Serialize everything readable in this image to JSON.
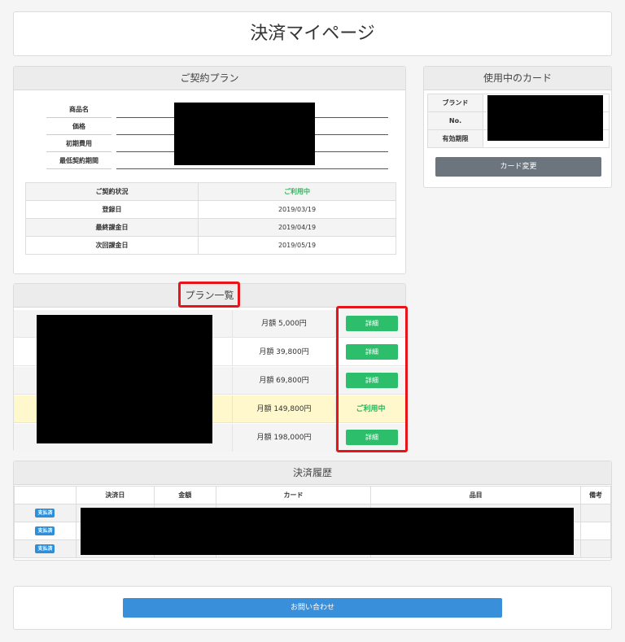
{
  "page": {
    "title": "決済マイページ"
  },
  "contract": {
    "heading": "ご契約プラン",
    "info_labels": [
      "商品名",
      "価格",
      "初期費用",
      "最低契約期間"
    ],
    "status_rows": [
      {
        "label": "ご契約状況",
        "value": "ご利用中"
      },
      {
        "label": "登録日",
        "value": "2019/03/19"
      },
      {
        "label": "最終課金日",
        "value": "2019/04/19"
      },
      {
        "label": "次回課金日",
        "value": "2019/05/19"
      }
    ]
  },
  "card": {
    "heading": "使用中のカード",
    "rows": [
      "ブランド",
      "No.",
      "有効期限"
    ],
    "change_button": "カード変更"
  },
  "plans": {
    "heading": "プラン一覧",
    "items": [
      {
        "price": "月額 5,000円",
        "action": "詳細"
      },
      {
        "price": "月額 39,800円",
        "action": "詳細"
      },
      {
        "price": "月額 69,800円",
        "action": "詳細"
      },
      {
        "price": "月額 149,800円",
        "status": "ご利用中"
      },
      {
        "price": "月額 198,000円",
        "action": "詳細"
      }
    ]
  },
  "history": {
    "heading": "決済履歴",
    "columns": [
      "",
      "決済日",
      "金額",
      "カード",
      "品目",
      "備考"
    ],
    "badges": [
      "支払済",
      "支払済",
      "支払済"
    ]
  },
  "footer": {
    "contact_button": "お問い合わせ"
  },
  "colors": {
    "accent_green": "#2dbe6c",
    "highlight_red": "#e8141a",
    "current_row": "#fff8cc",
    "blue_button": "#3a8fdb",
    "paid_badge": "#2d8fd8"
  }
}
